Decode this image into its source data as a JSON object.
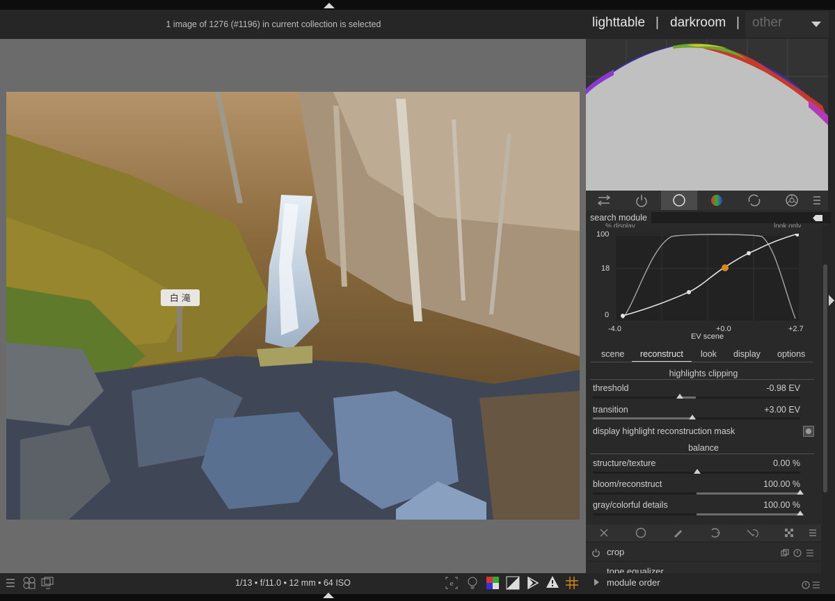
{
  "header": {
    "selection_info": "1 image of 1276 (#1196) in current collection is selected",
    "views": [
      "lighttable",
      "darkroom"
    ],
    "separator": "|",
    "other_view": "other"
  },
  "search": {
    "label": "search module",
    "placeholder": ""
  },
  "module_groups": [
    "quick-access-icon",
    "active-modules-icon",
    "base-group-icon",
    "color-group-icon",
    "correct-group-icon",
    "effect-group-icon",
    "presets-menu-icon"
  ],
  "filmic": {
    "graph_top_labels": [
      "% display",
      "look only"
    ],
    "y_ticks": [
      "100",
      "18",
      "0"
    ],
    "x_ticks": [
      "-4.0",
      "+0.0",
      "+2.7"
    ],
    "x_axis_title": "EV scene",
    "tabs": [
      "scene",
      "reconstruct",
      "look",
      "display",
      "options"
    ],
    "active_tab": "reconstruct",
    "section_highlights": "highlights clipping",
    "sliders": [
      {
        "label": "threshold",
        "value": "-0.98 EV",
        "fill": 0.42
      },
      {
        "label": "transition",
        "value": "+3.00 EV",
        "fill": 0.48
      }
    ],
    "mask_toggle_label": "display highlight reconstruction mask",
    "section_balance": "balance",
    "balance_sliders": [
      {
        "label": "structure/texture",
        "value": "0.00 %",
        "fill": 0.5
      },
      {
        "label": "bloom/reconstruct",
        "value": "100.00 %",
        "fill": 1.0
      },
      {
        "label": "gray/colorful details",
        "value": "100.00 %",
        "fill": 1.0
      }
    ]
  },
  "module_tools": [
    "reset-icon",
    "circle-mask-icon",
    "brush-icon",
    "parametric-mask-icon",
    "drawn-parametric-icon",
    "raster-mask-icon",
    "menu-icon"
  ],
  "modules": [
    {
      "name": "crop"
    },
    {
      "name": "tone equalizer"
    },
    {
      "name": "module order"
    }
  ],
  "footer": {
    "exif": "1/13 • f/11.0 • 12 mm • 64 ISO"
  },
  "colors": {
    "panel_bg": "#262626",
    "center_bg": "#6b6b6b",
    "accent_orange": "#d4891a"
  }
}
